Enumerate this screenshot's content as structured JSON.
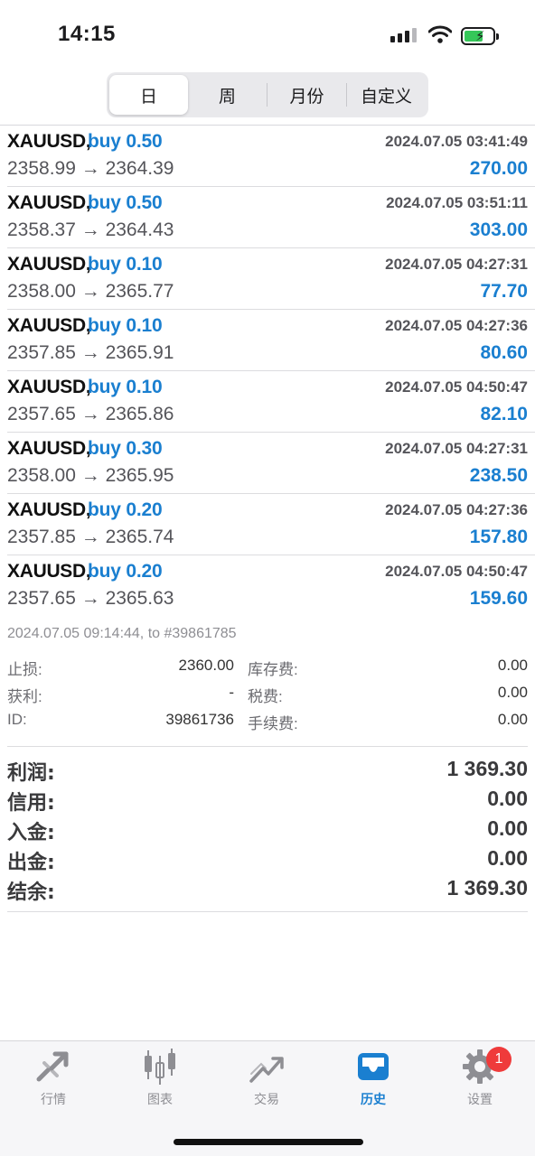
{
  "status": {
    "time": "14:15"
  },
  "tabs_period": [
    {
      "label": "日",
      "active": true
    },
    {
      "label": "周",
      "active": false
    },
    {
      "label": "月份",
      "active": false
    },
    {
      "label": "自定义",
      "active": false
    }
  ],
  "trades": [
    {
      "symbol": "XAUUSD,",
      "side": "buy 0.50",
      "time": "2024.07.05 03:41:49",
      "prices": "2358.99 → 2364.39",
      "profit": "270.00"
    },
    {
      "symbol": "XAUUSD,",
      "side": "buy 0.50",
      "time": "2024.07.05 03:51:11",
      "prices": "2358.37 → 2364.43",
      "profit": "303.00"
    },
    {
      "symbol": "XAUUSD,",
      "side": "buy 0.10",
      "time": "2024.07.05 04:27:31",
      "prices": "2358.00 → 2365.77",
      "profit": "77.70"
    },
    {
      "symbol": "XAUUSD,",
      "side": "buy 0.10",
      "time": "2024.07.05 04:27:36",
      "prices": "2357.85 → 2365.91",
      "profit": "80.60"
    },
    {
      "symbol": "XAUUSD,",
      "side": "buy 0.10",
      "time": "2024.07.05 04:50:47",
      "prices": "2357.65 → 2365.86",
      "profit": "82.10"
    },
    {
      "symbol": "XAUUSD,",
      "side": "buy 0.30",
      "time": "2024.07.05 04:27:31",
      "prices": "2358.00 → 2365.95",
      "profit": "238.50"
    },
    {
      "symbol": "XAUUSD,",
      "side": "buy 0.20",
      "time": "2024.07.05 04:27:36",
      "prices": "2357.85 → 2365.74",
      "profit": "157.80"
    },
    {
      "symbol": "XAUUSD,",
      "side": "buy 0.20",
      "time": "2024.07.05 04:50:47",
      "prices": "2357.65 → 2365.63",
      "profit": "159.60"
    }
  ],
  "detail": {
    "header": "2024.07.05 09:14:44, to #39861785",
    "stop_loss_label": "止损:",
    "stop_loss_value": "2360.00",
    "swap_label": "库存费:",
    "swap_value": "0.00",
    "take_profit_label": "获利:",
    "take_profit_value": "-",
    "tax_label": "税费:",
    "tax_value": "0.00",
    "id_label": "ID:",
    "id_value": "39861736",
    "commission_label": "手续费:",
    "commission_value": "0.00"
  },
  "summary": [
    {
      "label": "利润:",
      "value": "1 369.30"
    },
    {
      "label": "信用:",
      "value": "0.00"
    },
    {
      "label": "入金:",
      "value": "0.00"
    },
    {
      "label": "出金:",
      "value": "0.00"
    },
    {
      "label": "结余:",
      "value": "1 369.30"
    }
  ],
  "nav": [
    {
      "label": "行情",
      "icon": "quotes-icon",
      "active": false
    },
    {
      "label": "图表",
      "icon": "candlestick-chart-icon",
      "active": false
    },
    {
      "label": "交易",
      "icon": "trade-icon",
      "active": false
    },
    {
      "label": "历史",
      "icon": "history-inbox-icon",
      "active": true
    },
    {
      "label": "设置",
      "icon": "gear-icon",
      "active": false,
      "badge": "1"
    }
  ],
  "colors": {
    "accent": "#1a7fd0",
    "badge": "#ef3b3b",
    "battery": "#35c759"
  }
}
